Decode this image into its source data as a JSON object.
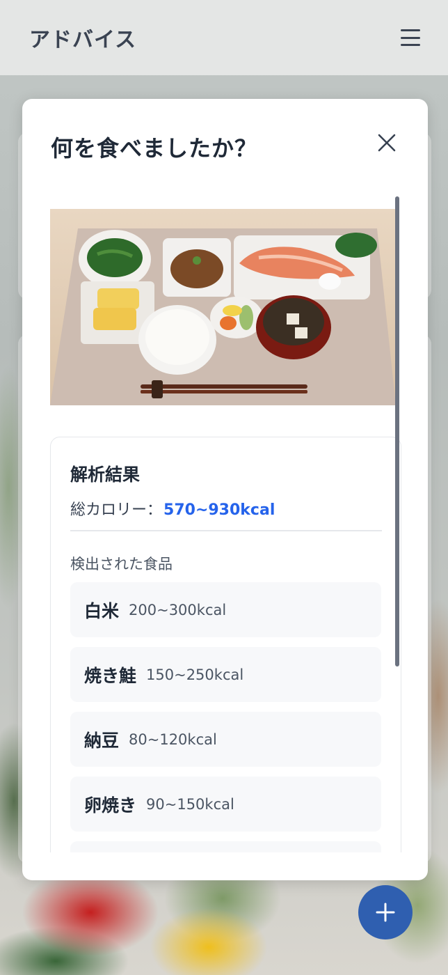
{
  "header": {
    "title": "アドバイス",
    "menu_icon": "hamburger-menu-icon"
  },
  "modal": {
    "title": "何を食べましたか？",
    "close_icon": "close-icon",
    "photo_description_icon": "meal-photo"
  },
  "result": {
    "title": "解析結果",
    "total_label": "総カロリー：",
    "total_value": "570~930kcal",
    "detected_label": "検出された食品",
    "foods": [
      {
        "name": "白米",
        "kcal": "200~300kcal"
      },
      {
        "name": "焼き鮭",
        "kcal": "150~250kcal"
      },
      {
        "name": "納豆",
        "kcal": "80~120kcal"
      },
      {
        "name": "卵焼き",
        "kcal": "90~150kcal"
      }
    ]
  },
  "fab": {
    "icon": "plus-icon"
  },
  "colors": {
    "accent": "#2563eb",
    "fab": "#2f5fb0",
    "title_text": "#3a4352"
  }
}
